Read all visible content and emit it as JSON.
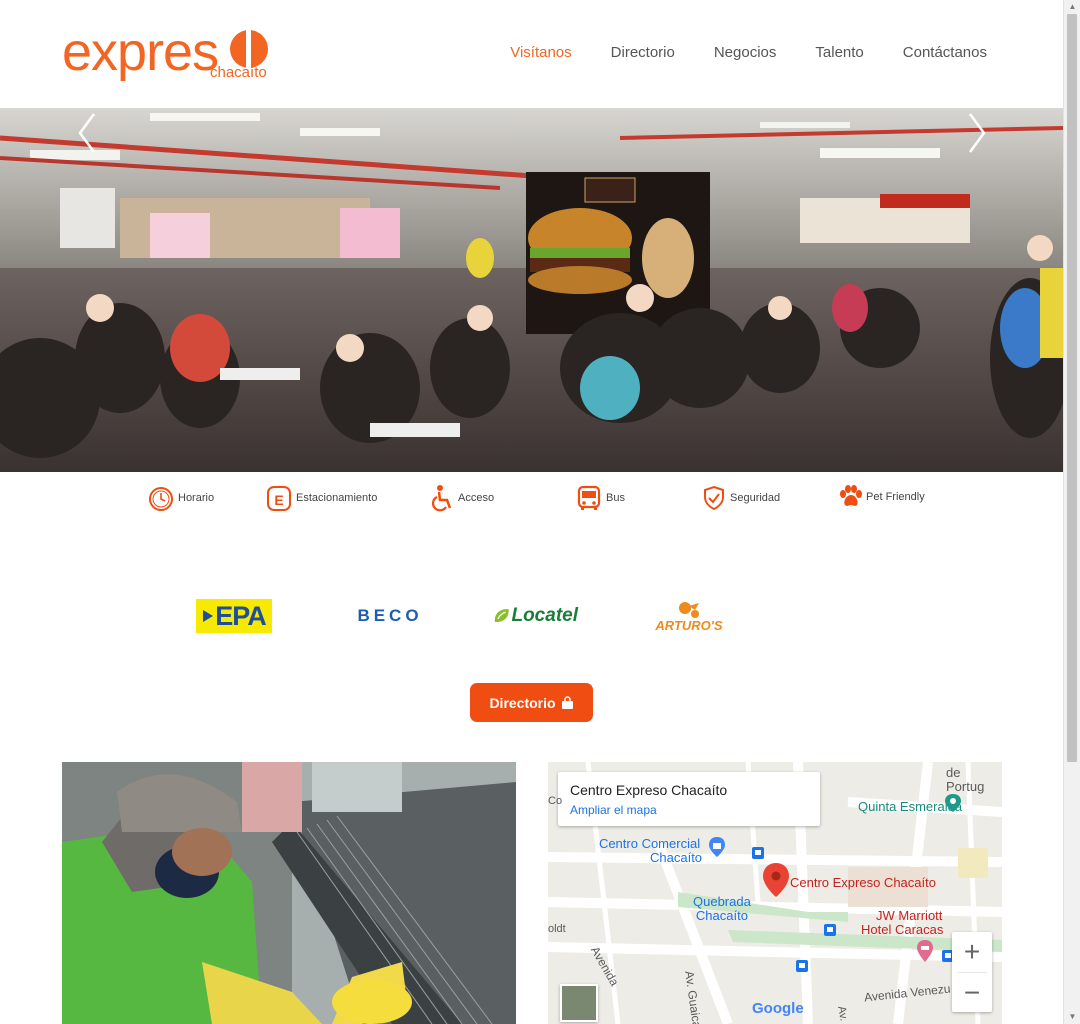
{
  "brand": {
    "name": "expres",
    "subtitle": "chacaíto",
    "accent_color": "#f26522"
  },
  "nav": {
    "items": [
      {
        "label": "Visítanos",
        "active": true
      },
      {
        "label": "Directorio",
        "active": false
      },
      {
        "label": "Negocios",
        "active": false
      },
      {
        "label": "Talento",
        "active": false
      },
      {
        "label": "Contáctanos",
        "active": false
      }
    ]
  },
  "hero": {
    "prev_icon": "chevron-left-icon",
    "next_icon": "chevron-right-icon"
  },
  "info": {
    "items": [
      {
        "label": "Horario",
        "icon": "clock-icon"
      },
      {
        "label": "Estacionamiento",
        "icon": "parking-icon"
      },
      {
        "label": "Acceso",
        "icon": "wheelchair-icon"
      },
      {
        "label": "Bus",
        "icon": "bus-icon"
      },
      {
        "label": "Seguridad",
        "icon": "shield-icon"
      },
      {
        "label": "Pet Friendly",
        "icon": "paw-icon"
      }
    ]
  },
  "brands": {
    "epa": "EPA",
    "beco": "BECO",
    "locatel": "Locatel",
    "arturos": "ARTURO'S"
  },
  "directory_button": {
    "label": "Directorio",
    "icon": "shopping-bag-icon",
    "color": "#f04d12"
  },
  "map": {
    "card_title": "Centro Expreso Chacaíto",
    "card_link": "Ampliar el mapa",
    "labels": {
      "portugal": "de Portug",
      "quinta": "Quinta Esmeralda",
      "centro_comercial_1": "Centro Comercial",
      "centro_comercial_2": "Chacaíto",
      "marker_label": "Centro Expreso Chacaíto",
      "quebrada_1": "Quebrada",
      "quebrada_2": "Chacaíto",
      "jw_1": "JW Marriott",
      "jw_2": "Hotel Caracas",
      "av_guaicaipuro": "Av. Guaicaipuro",
      "avenida_left": "Avenida",
      "avenida_venez": "Avenida Venezu",
      "left_co": "Co",
      "left_oldt": "oldt",
      "av_bottom": "Av."
    },
    "google": "Google",
    "zoom_in": "+",
    "zoom_out": "−"
  }
}
